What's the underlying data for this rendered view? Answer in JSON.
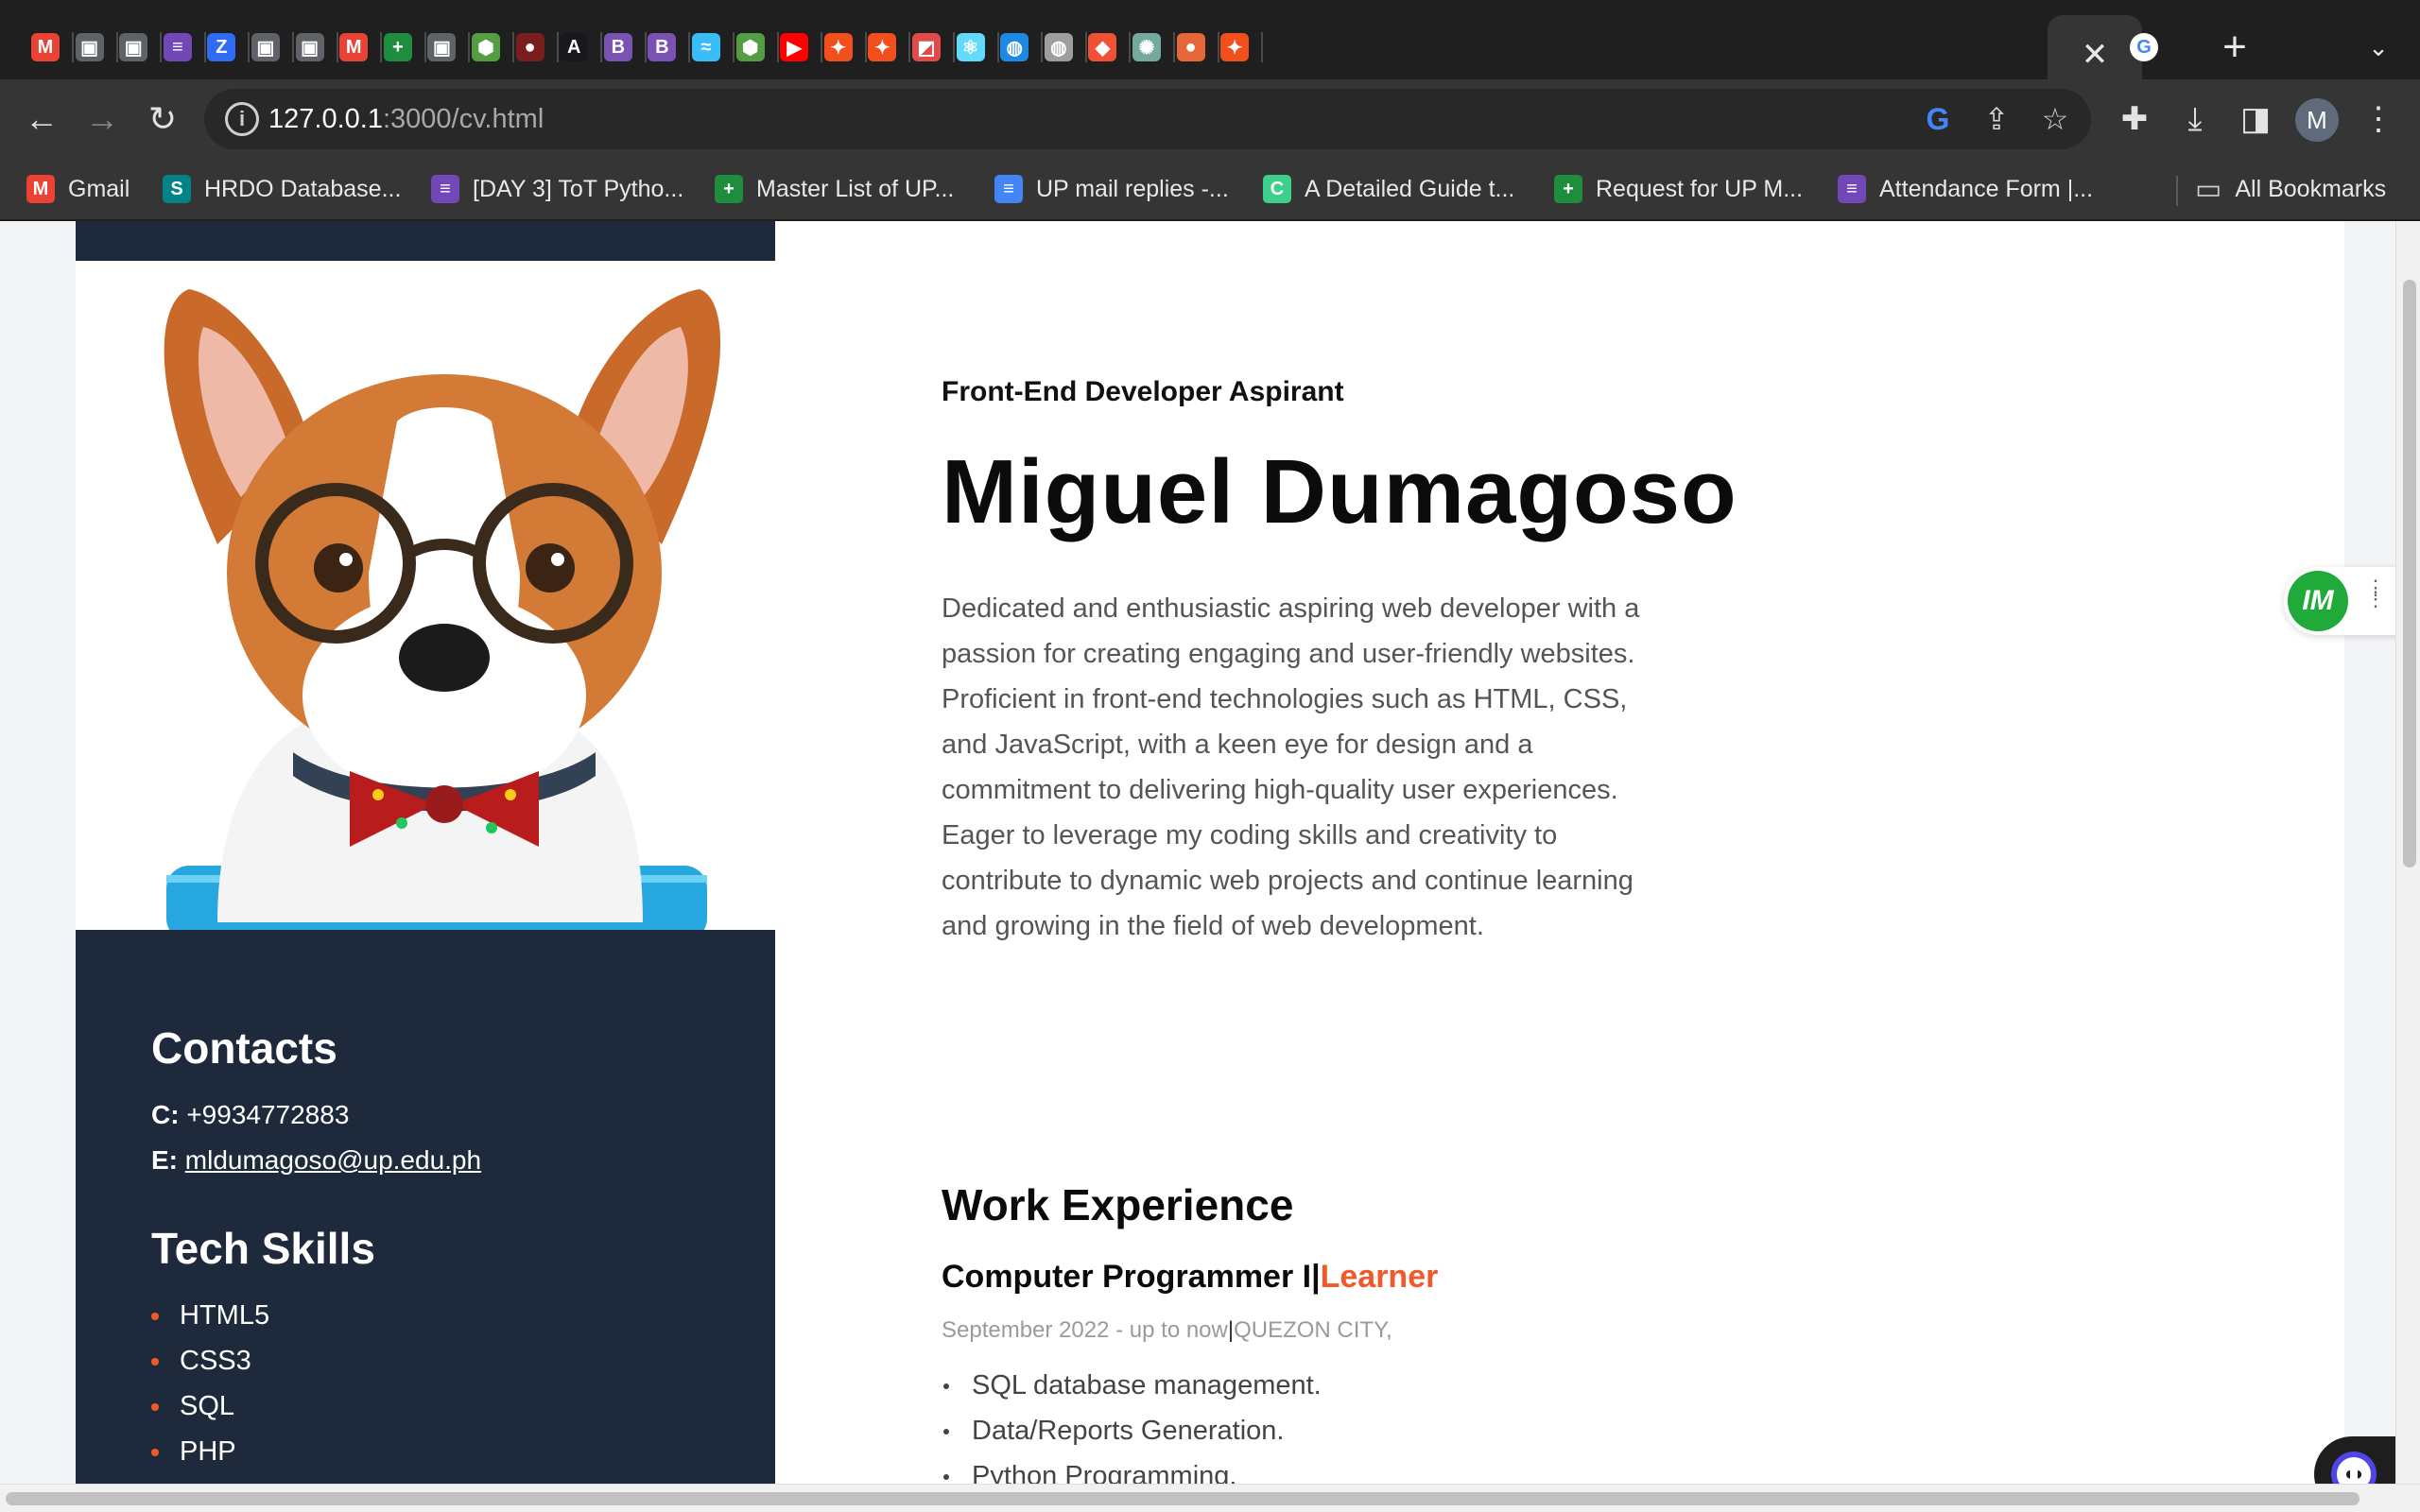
{
  "browser": {
    "tabs": [
      {
        "icon": "gmail-icon",
        "glyph": "M",
        "color": "#ea4335"
      },
      {
        "icon": "contacts-icon",
        "glyph": "▣",
        "color": "#5f6368"
      },
      {
        "icon": "contacts-icon",
        "glyph": "▣",
        "color": "#5f6368"
      },
      {
        "icon": "forms-icon",
        "glyph": "≡",
        "color": "#7248b9"
      },
      {
        "icon": "zoho-icon",
        "glyph": "Z",
        "color": "#2f6cf5"
      },
      {
        "icon": "contacts-icon",
        "glyph": "▣",
        "color": "#5f6368"
      },
      {
        "icon": "contacts-icon",
        "glyph": "▣",
        "color": "#5f6368"
      },
      {
        "icon": "gmail-icon",
        "glyph": "M",
        "color": "#ea4335"
      },
      {
        "icon": "sheets-icon",
        "glyph": "+",
        "color": "#1e8e3e"
      },
      {
        "icon": "contacts-icon",
        "glyph": "▣",
        "color": "#5f6368"
      },
      {
        "icon": "nodejs-icon",
        "glyph": "⬢",
        "color": "#539e43"
      },
      {
        "icon": "university-seal-icon",
        "glyph": "●",
        "color": "#7a1d1d"
      },
      {
        "icon": "astro-icon",
        "glyph": "A",
        "color": "#17191e"
      },
      {
        "icon": "bootstrap-icon",
        "glyph": "B",
        "color": "#7952b3"
      },
      {
        "icon": "bootstrap-icon",
        "glyph": "B",
        "color": "#7952b3"
      },
      {
        "icon": "tailwind-icon",
        "glyph": "≈",
        "color": "#38bdf8"
      },
      {
        "icon": "nodejs-icon",
        "glyph": "⬢",
        "color": "#539e43"
      },
      {
        "icon": "youtube-icon",
        "glyph": "▶",
        "color": "#ff0000"
      },
      {
        "icon": "figma-icon",
        "glyph": "✦",
        "color": "#f24e1e"
      },
      {
        "icon": "figma-icon",
        "glyph": "✦",
        "color": "#f24e1e"
      },
      {
        "icon": "app-icon",
        "glyph": "◩",
        "color": "#e04a4a"
      },
      {
        "icon": "react-icon",
        "glyph": "⚛",
        "color": "#61dafb"
      },
      {
        "icon": "globe-icon",
        "glyph": "◍",
        "color": "#1e88e5"
      },
      {
        "icon": "globe-icon",
        "glyph": "◍",
        "color": "#9e9e9e"
      },
      {
        "icon": "git-icon",
        "glyph": "◆",
        "color": "#f05033"
      },
      {
        "icon": "chatgpt-icon",
        "glyph": "✺",
        "color": "#74aa9c"
      },
      {
        "icon": "app-icon",
        "glyph": "●",
        "color": "#e6673a"
      },
      {
        "icon": "figma-icon",
        "glyph": "✦",
        "color": "#f24e1e"
      }
    ],
    "active_tab": {
      "icon": "google-icon",
      "glyph": "G",
      "close": "✕"
    },
    "new_tab": "+",
    "tab_menu": "⌄",
    "url_host": "127.0.0.1",
    "url_rest": ":3000/cv.html",
    "profile_initial": "M",
    "bookmarks": [
      {
        "label": "Gmail",
        "icon": "gmail-icon",
        "glyph": "M",
        "color": "#ea4335"
      },
      {
        "label": "HRDO Database...",
        "icon": "sharepoint-icon",
        "glyph": "S",
        "color": "#038387"
      },
      {
        "label": "[DAY 3] ToT Pytho...",
        "icon": "forms-icon",
        "glyph": "≡",
        "color": "#7248b9"
      },
      {
        "label": "Master List of UP...",
        "icon": "sheets-icon",
        "glyph": "+",
        "color": "#1e8e3e"
      },
      {
        "label": "UP mail replies -...",
        "icon": "docs-icon",
        "glyph": "≡",
        "color": "#4285f4"
      },
      {
        "label": "A Detailed Guide t...",
        "icon": "guide-icon",
        "glyph": "C",
        "color": "#3ecf8e"
      },
      {
        "label": "Request for UP M...",
        "icon": "sheets-icon",
        "glyph": "+",
        "color": "#1e8e3e"
      },
      {
        "label": "Attendance Form |...",
        "icon": "forms-icon",
        "glyph": "≡",
        "color": "#7248b9"
      }
    ],
    "all_bookmarks": "All Bookmarks"
  },
  "cv": {
    "subtitle": "Front-End Developer Aspirant",
    "name": "Miguel Dumagoso",
    "summary": "Dedicated and enthusiastic aspiring web developer with a passion for creating engaging and user-friendly websites. Proficient in front-end technologies such as HTML, CSS, and JavaScript, with a keen eye for design and a commitment to delivering high-quality user experiences. Eager to leverage my coding skills and creativity to contribute to dynamic web projects and continue learning and growing in the field of web development.",
    "contacts_heading": "Contacts",
    "phone_label": "C:",
    "phone": "+9934772883",
    "email_label": "E:",
    "email": "mldumagoso@up.edu.ph",
    "skills_heading": "Tech Skills",
    "skills": [
      "HTML5",
      "CSS3",
      "SQL",
      "PHP"
    ],
    "work_heading": "Work Experience",
    "job_title": "Computer Programmer I",
    "job_sep": "|",
    "job_company": "Learner",
    "job_dates": "September 2022 - up to now",
    "job_meta_sep": "|",
    "job_location": "QUEZON CITY,",
    "duties": [
      "SQL database management.",
      "Data/Reports Generation.",
      "Python Programming."
    ]
  },
  "widgets": {
    "im_badge": "IM",
    "bot_glyph": "◖◗"
  }
}
